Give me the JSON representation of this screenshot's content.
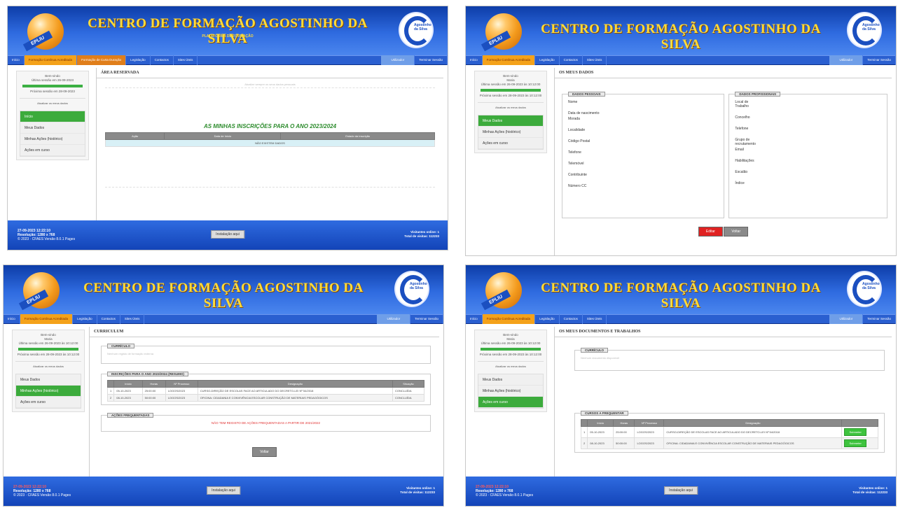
{
  "app": {
    "title": "CENTRO DE FORMAÇÃO AGOSTINHO DA SILVA",
    "subtitle": "PLATAFORMA DE FORMAÇÃO",
    "logo_text": "EPLIU",
    "emblem_text": "Agostinho da Silva",
    "nav": {
      "home": "Início",
      "courses": "Formação Contínua Acreditada",
      "short_courses": "Formação de Curta Duração",
      "legislation": "Legislação",
      "contacts": "Contactos",
      "useful_links": "Sites Úteis",
      "account": "Utilizador",
      "logout": "Terminar Sessão"
    },
    "footer": {
      "datetime": "27-09-2023 12:22:10",
      "resolution": "Resolução: 1280 x 768",
      "copyright": "© 2023 · CFAES Versão 8.0.1 Pages",
      "center_button": "Instalação aqui",
      "online": "Visitantes online: 1",
      "total": "Total de visitas: 112233"
    },
    "colors": {
      "header": "#2f6be0",
      "title": "#ffdc3a",
      "accent": "#3cab3c",
      "danger": "#e02222"
    }
  },
  "panel1": {
    "sidebar": {
      "greeting": "Bem-vindo",
      "line1": "Última sessão em 26-09-2023",
      "line2": "Próxima sessão em 28-09-2023",
      "link": "Atualizar os meus dados"
    },
    "menu": [
      "Início",
      "Meus Dados",
      "Minhas Ações (histórico)",
      "Ações em curso"
    ],
    "page_title": "ÁREA RESERVADA",
    "notice": "Atualize sempre os seus dados pessoais",
    "heading": "AS MINHAS INSCRIÇÕES PARA O ANO 2023/2024",
    "table": {
      "headers": [
        "Ação",
        "Data de Início",
        "Estado da inscrição"
      ],
      "empty": "NÃO EXISTEM DADOS"
    }
  },
  "panel2": {
    "sidebar": {
      "greeting": "Bem-vindo",
      "name": "Maria",
      "line1": "Última sessão em 26-09-2023 às 10:12:00",
      "line2": "Próxima sessão em 28-09-2023 às 10:12:00",
      "link": "Atualizar os meus dados"
    },
    "menu": [
      "Meus Dados",
      "Minhas Ações (histórico)",
      "Ações em curso"
    ],
    "page_title": "OS MEUS DADOS",
    "personal_legend": "DADOS PESSOAIS",
    "personal_fields": [
      "Nome",
      "Data de nascimento",
      "Morada",
      "Localidade",
      "Código Postal",
      "Telefone",
      "Telemóvel",
      "Contribuinte",
      "Número CC"
    ],
    "pro_legend": "DADOS PROFISSIONAIS",
    "pro_fields": [
      "Local de Trabalho",
      "Concelho",
      "Telefone",
      "Grupo de recrutamento",
      "Email",
      "Habilitações",
      "Escalão",
      "Índice"
    ],
    "buttons": {
      "edit": "Editar",
      "back": "Voltar"
    }
  },
  "panel3": {
    "sidebar": {
      "greeting": "Bem-vindo",
      "name": "Maria",
      "line1": "Última sessão em 26-09-2023 às 10:12:00",
      "line2": "Próxima sessão em 28-09-2023 às 10:12:00",
      "link": "Atualizar os meus dados"
    },
    "menu": [
      "Meus Dados",
      "Minhas Ações (histórico)",
      "Ações em curso"
    ],
    "page_title": "CURRICULUM",
    "summary_legend": "CURRÍCULO",
    "summary_text": "Nenhum registo de formação externa",
    "table_legend": "INSCRIÇÕES PARA O ANO 2023/2024 (RESUMO)",
    "table": {
      "headers": [
        "",
        "Início",
        "Horas",
        "Nº Processo",
        "Designação",
        "Situação"
      ],
      "rows": [
        [
          "1",
          "05-10-2023",
          "25:00:00",
          "LOGOS/2023",
          "CURSO-DIREÇÃO DE ESCOLAS FACE AO ARTICULADO DO DECRETO-LEI Nº 54/2018",
          "CONCLUÍDA"
        ],
        [
          "2",
          "08-10-2023",
          "50:00:00",
          "LOGOS/2023",
          "OFICINA: CIDADANIA E CONVIVÊNCIA ESCOLAR CONSTRUÇÃO DE MATERIAIS PEDAGÓGICOS",
          "CONCLUÍDA"
        ]
      ]
    },
    "prereq_legend": "AÇÕES FREQUENTADAS",
    "prereq_warning": "NÃO TEM REGISTO DE AÇÕES FREQUENTADAS A PARTIR DE 2021/2022",
    "back": "Voltar"
  },
  "panel4": {
    "sidebar": {
      "greeting": "Bem-vindo",
      "name": "Maria",
      "line1": "Última sessão em 26-09-2023 às 10:12:00",
      "line2": "Próxima sessão em 28-09-2023 às 10:12:00",
      "link": "Atualizar os meus dados"
    },
    "menu": [
      "Meus Dados",
      "Minhas Ações (histórico)",
      "Ações em curso"
    ],
    "page_title": "OS MEUS DOCUMENTOS E TRABALHOS",
    "summary_legend": "CURRÍCULO",
    "summary_text": "Nenhum documento disponível",
    "docs_legend": "CURSOS A FREQUENTAR",
    "table": {
      "headers": [
        "",
        "Início",
        "Horas",
        "Nº Processo",
        "Designação",
        ""
      ],
      "rows": [
        [
          "1",
          "05-10-2023",
          "25:00:00",
          "LOGOS/2023",
          "CURSO-DIREÇÃO DE ESCOLAS FACE AO ARTICULADO DO DECRETO-LEI Nº 54/2018",
          "Submeter"
        ],
        [
          "2",
          "08-10-2023",
          "50:00:00",
          "LOGOS/2023",
          "OFICINA: CIDADANIA E CONVIVÊNCIA ESCOLAR CONSTRUÇÃO DE MATERIAIS PEDAGÓGICOS",
          "Submeter"
        ]
      ]
    }
  }
}
